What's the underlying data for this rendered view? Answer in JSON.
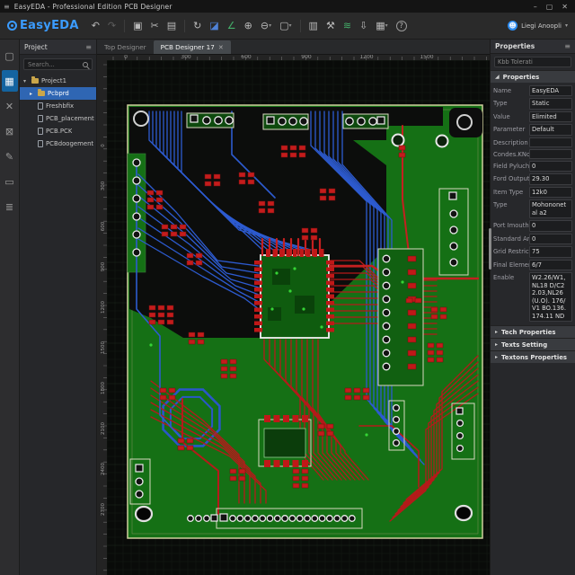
{
  "window": {
    "title": "EasyEDA - Professional Edition PCB Designer",
    "menu_icon": "≡",
    "controls": {
      "minimize": "–",
      "maximize": "▢",
      "close": "✕"
    }
  },
  "toolbar": {
    "logo_text": "EasyEDA",
    "icons": [
      {
        "name": "undo-icon",
        "glyph": "↶"
      },
      {
        "name": "redo-icon",
        "glyph": "↷"
      },
      {
        "name": "snapshot-icon",
        "glyph": "▣"
      },
      {
        "name": "cut-icon",
        "glyph": "✂"
      },
      {
        "name": "copy-icon",
        "glyph": "▤"
      },
      {
        "name": "refresh-icon",
        "glyph": "↻"
      },
      {
        "name": "layer-view-icon",
        "glyph": "◪"
      },
      {
        "name": "measure-icon",
        "glyph": "∠"
      },
      {
        "name": "zoom-in-icon",
        "glyph": "⊕"
      },
      {
        "name": "zoom-out-icon",
        "glyph": "⊖"
      },
      {
        "name": "frame-select-icon",
        "glyph": "▢"
      },
      {
        "name": "stats-icon",
        "glyph": "▥"
      },
      {
        "name": "tools-icon",
        "glyph": "⚒"
      },
      {
        "name": "wave-check-icon",
        "glyph": "≋"
      },
      {
        "name": "export-icon",
        "glyph": "⇩"
      },
      {
        "name": "grid-settings-icon",
        "glyph": "▦"
      },
      {
        "name": "help-icon",
        "glyph": "?"
      }
    ],
    "dropdown_caret": "▾",
    "user": {
      "name": "Liegi Anoopli",
      "caret": "▾",
      "avatar_glyph": "☻"
    }
  },
  "left_rail": {
    "icons": [
      {
        "name": "file-icon",
        "glyph": "▢"
      },
      {
        "name": "layers-board-icon",
        "glyph": "▦"
      },
      {
        "name": "cross-probe-icon",
        "glyph": "✕"
      },
      {
        "name": "export-board-icon",
        "glyph": "⊠"
      },
      {
        "name": "edit-pen-icon",
        "glyph": "✎"
      },
      {
        "name": "footprint-icon",
        "glyph": "▭"
      },
      {
        "name": "netlist-icon",
        "glyph": "≣"
      }
    ]
  },
  "project_panel": {
    "title": "Project",
    "menu_icon": "≡",
    "search_placeholder": "Search...",
    "tree": [
      {
        "label": "Project1",
        "type": "folder",
        "arrow": "▾",
        "selected": false
      },
      {
        "label": "Pcbprd",
        "type": "folder",
        "arrow": "▸",
        "selected": true
      },
      {
        "label": "Freshbfix",
        "type": "file",
        "arrow": "",
        "selected": false
      },
      {
        "label": "PCB_placement",
        "type": "file",
        "arrow": "",
        "selected": false
      },
      {
        "label": "PCB.PCK",
        "type": "file",
        "arrow": "",
        "selected": false
      },
      {
        "label": "PCBdoogement",
        "type": "file",
        "arrow": "",
        "selected": false
      }
    ]
  },
  "tabs": [
    {
      "label": "Top Designer",
      "active": false,
      "close": ""
    },
    {
      "label": "PCB Designer 17",
      "active": true,
      "close": "✕"
    }
  ],
  "canvas": {
    "ruler_top": [
      "0",
      "300",
      "600",
      "900",
      "1200",
      "1500"
    ],
    "ruler_left": [
      "0",
      "300",
      "600",
      "900",
      "1200",
      "1500",
      "1800",
      "2100",
      "2400",
      "2700"
    ]
  },
  "properties_panel": {
    "title": "Properties",
    "menu_icon": "≡",
    "filter_value": "Kbb Tolerati",
    "main_section": {
      "label": "Properties",
      "arrow": "◢"
    },
    "rows": [
      {
        "label": "Name",
        "value": "EasyEDA"
      },
      {
        "label": "Type",
        "value": "Static"
      },
      {
        "label": "Value",
        "value": "Elimited"
      },
      {
        "label": "Parameter",
        "value": "Default"
      },
      {
        "label": "Description",
        "value": ""
      },
      {
        "label": "Condes.KNo.",
        "value": ""
      },
      {
        "label": "Field Pylucho",
        "value": "0"
      },
      {
        "label": "Ford Outputs",
        "value": "29.30"
      },
      {
        "label": "Item Type",
        "value": "12k0"
      },
      {
        "label": "Type",
        "value": "Mohononetal a2"
      },
      {
        "label": "Port Imouth...",
        "value": "0"
      },
      {
        "label": "Standard Area",
        "value": "0"
      },
      {
        "label": "Grid Restrict...",
        "value": "75"
      },
      {
        "label": "Final Element...",
        "value": "6/7"
      },
      {
        "label": "Enable",
        "value": "W2.26/W1,NL18 D/C22.03,NL26 (U.O). 176/V1 BO.136.174.11 ND"
      }
    ],
    "collapsed_sections": [
      {
        "label": "Tech Properties",
        "arrow": "▸"
      },
      {
        "label": "Texts Setting",
        "arrow": "▸"
      },
      {
        "label": "Textons Properties",
        "arrow": "▸"
      }
    ]
  },
  "colors": {
    "accent_blue": "#3b9cff",
    "selection_blue": "#2f66b3",
    "board_green": "#157015",
    "trace_blue": "#2d5bd0",
    "trace_red": "#b51a1a",
    "silkscreen": "#e8e8e8"
  }
}
